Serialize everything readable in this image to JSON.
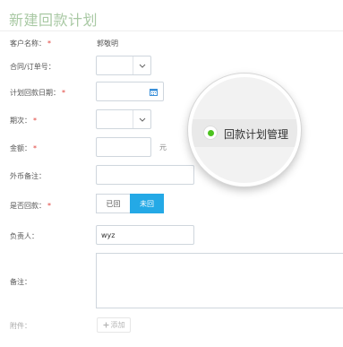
{
  "page": {
    "title": "新建回款计划"
  },
  "form": {
    "customer": {
      "label": "客户名称：",
      "value": "郭敬明"
    },
    "contract": {
      "label": "合同/订单号："
    },
    "plan_date": {
      "label": "计划回款日期："
    },
    "period": {
      "label": "期次："
    },
    "amount": {
      "label": "金额：",
      "unit": "元"
    },
    "fx_note": {
      "label": "外币备注："
    },
    "is_returned": {
      "label": "是否回款：",
      "options": [
        "已回",
        "未回"
      ],
      "selected": "未回"
    },
    "owner": {
      "label": "负责人：",
      "value": "wyz"
    },
    "remark": {
      "label": "备注："
    },
    "attachment": {
      "label": "附件：",
      "add_label": "添加"
    }
  },
  "magnifier": {
    "text": "回款计划管理",
    "dot_color": "#4cc31f"
  },
  "required_marker": "*",
  "colors": {
    "accent": "#24a9e6",
    "title": "#a9c9a4",
    "required": "#e0403a"
  }
}
